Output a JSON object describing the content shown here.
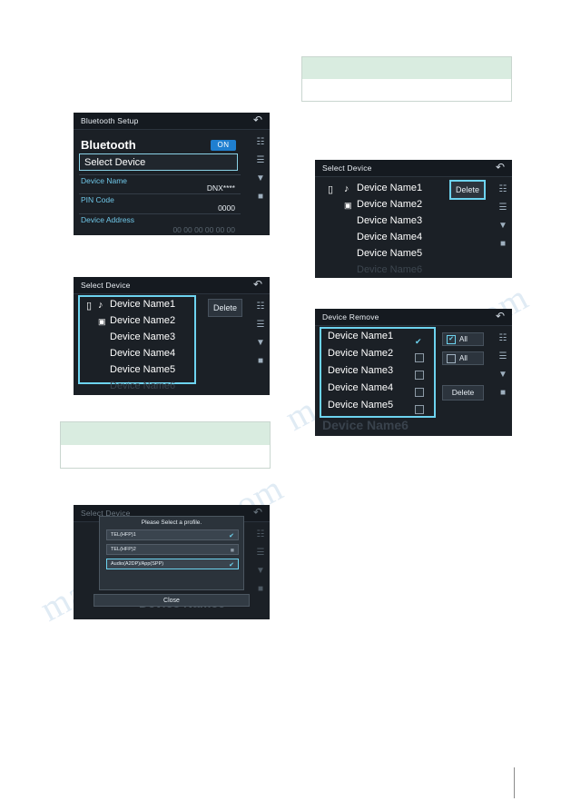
{
  "panels": {
    "bluetooth_setup": {
      "title": "Bluetooth Setup",
      "heading": "Bluetooth",
      "toggle_label": "ON",
      "select_device": "Select Device",
      "rows": [
        {
          "label": "Device Name",
          "value": "DNX****"
        },
        {
          "label": "PIN Code",
          "value": "0000"
        },
        {
          "label": "Device Address",
          "value": "00 00 00 00 00 00"
        }
      ],
      "back_icon": "back-arrow-icon",
      "rail_icons": [
        "volume-icon",
        "menu-icon",
        "home-icon"
      ]
    },
    "select_device_left": {
      "title": "Select Device",
      "devices": [
        "Device Name1",
        "Device Name2",
        "Device Name3",
        "Device Name4",
        "Device Name5",
        "Device Name6"
      ],
      "delete_label": "Delete",
      "back_icon": "back-arrow-icon"
    },
    "profile_dialog": {
      "title": "Select Device",
      "dialog_title": "Please Select a profile.",
      "profiles": [
        {
          "label": "TEL(HFP)1",
          "checked": true
        },
        {
          "label": "TEL(HFP)2",
          "checked": false
        },
        {
          "label": "Audio(A2DP)/App(SPP)",
          "checked": true
        }
      ],
      "close_label": "Close",
      "background_device": "Device Name6"
    },
    "select_device_right": {
      "title": "Select Device",
      "devices": [
        "Device Name1",
        "Device Name2",
        "Device Name3",
        "Device Name4",
        "Device Name5",
        "Device Name6"
      ],
      "delete_label": "Delete",
      "back_icon": "back-arrow-icon"
    },
    "device_remove": {
      "title": "Device Remove",
      "devices": [
        "Device Name1",
        "Device Name2",
        "Device Name3",
        "Device Name4",
        "Device Name5"
      ],
      "background_device": "Device Name6",
      "all_check_label": "All",
      "all_uncheck_label": "All",
      "delete_label": "Delete",
      "back_icon": "back-arrow-icon"
    }
  },
  "watermark": {
    "line1": "manualshive.com",
    "line2": "manualshive.com"
  },
  "colors": {
    "panel_bg": "#1b2026",
    "accent_cyan": "#6dd3ef",
    "badge_blue": "#1f7fd0",
    "note_green": "#d9ece0"
  }
}
